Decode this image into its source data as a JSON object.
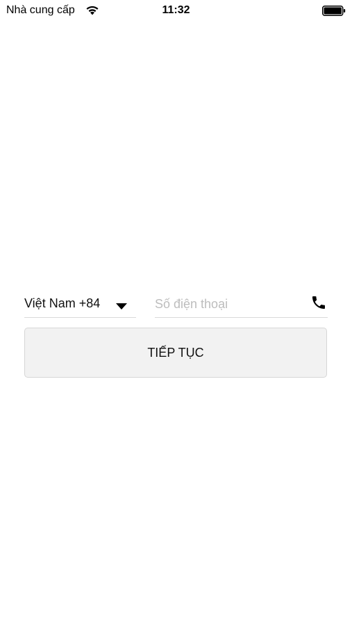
{
  "status_bar": {
    "carrier": "Nhà cung cấp",
    "time": "11:32",
    "wifi_icon": "wifi-icon",
    "battery_icon": "battery-full-icon"
  },
  "form": {
    "country_select": {
      "value": "Việt Nam +84",
      "icon": "dropdown-triangle-icon"
    },
    "phone_input": {
      "placeholder": "Số điện thoại",
      "value": "",
      "icon": "phone-icon"
    },
    "continue_button": {
      "label": "TIẾP TỤC"
    }
  },
  "colors": {
    "background": "#ffffff",
    "button_bg": "#f2f2f2",
    "border": "#d9d9d9",
    "placeholder": "#bdbdbd"
  }
}
